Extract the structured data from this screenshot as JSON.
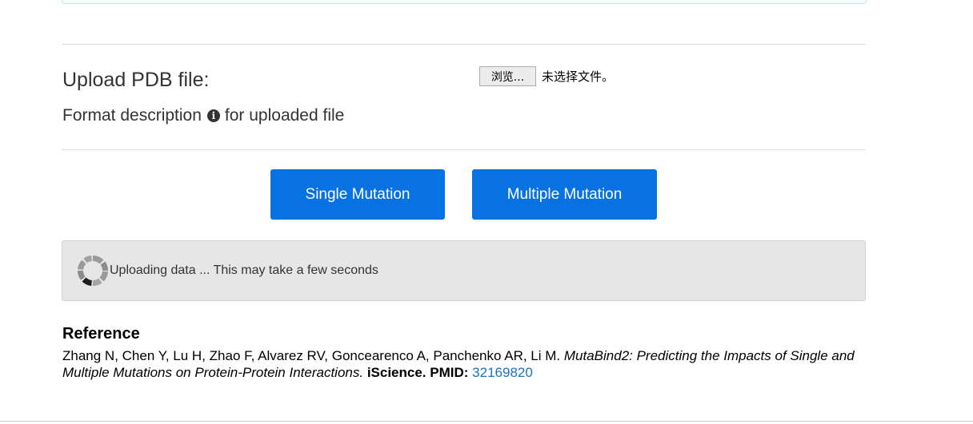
{
  "upload": {
    "label": "Upload PDB file:",
    "browse_label": "浏览...",
    "file_status": "未选择文件。"
  },
  "format": {
    "prefix": "Format description",
    "icon": "info-icon",
    "suffix": "for uploaded file"
  },
  "buttons": {
    "single": "Single Mutation",
    "multiple": "Multiple Mutation"
  },
  "status": {
    "icon": "loading-spinner-icon",
    "text": "Uploading data ... This may take a few seconds"
  },
  "reference": {
    "heading": "Reference",
    "authors": "Zhang N, Chen Y, Lu H, Zhao F, Alvarez RV, Goncearenco A, Panchenko AR, Li M.",
    "title": "MutaBind2: Predicting the Impacts of Single and Multiple Mutations on Protein-Protein Interactions.",
    "journal": "iScience.",
    "pmid_label": "PMID:",
    "pmid": "32169820"
  },
  "colors": {
    "primary_button": "#0872e2",
    "link": "#1a72c6",
    "status_bg": "#e6e6e6"
  }
}
